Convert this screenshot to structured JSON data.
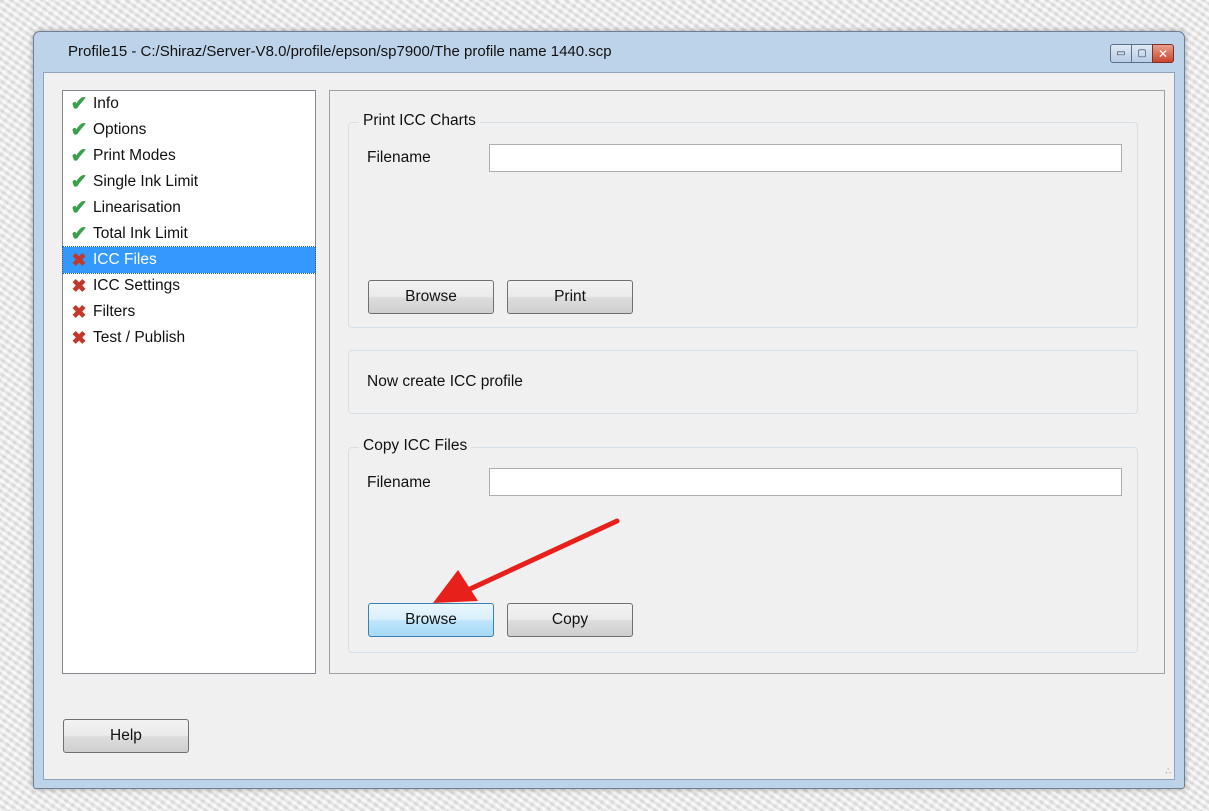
{
  "window": {
    "title": "Profile15 - C:/Shiraz/Server-V8.0/profile/epson/sp7900/The profile name 1440.scp",
    "controls": {
      "minimize": "▭",
      "maximize": "▢",
      "close": "✕"
    }
  },
  "nav": {
    "items": [
      {
        "label": "Info",
        "status": "done"
      },
      {
        "label": "Options",
        "status": "done"
      },
      {
        "label": "Print Modes",
        "status": "done"
      },
      {
        "label": "Single Ink Limit",
        "status": "done"
      },
      {
        "label": "Linearisation",
        "status": "done"
      },
      {
        "label": "Total Ink Limit",
        "status": "done"
      },
      {
        "label": "ICC Files",
        "status": "todo",
        "selected": true
      },
      {
        "label": "ICC Settings",
        "status": "todo"
      },
      {
        "label": "Filters",
        "status": "todo"
      },
      {
        "label": "Test / Publish",
        "status": "todo"
      }
    ],
    "icons": {
      "done": "✔",
      "todo": "✖"
    },
    "colors": {
      "done": "#3aa04a",
      "todo": "#c0392b",
      "selected_bg": "#3399ff"
    }
  },
  "print_charts": {
    "legend": "Print ICC Charts",
    "filename_label": "Filename",
    "filename_value": "",
    "browse_label": "Browse",
    "print_label": "Print"
  },
  "create_profile": {
    "message": "Now create ICC profile"
  },
  "copy_files": {
    "legend": "Copy ICC Files",
    "filename_label": "Filename",
    "filename_value": "",
    "browse_label": "Browse",
    "copy_label": "Copy"
  },
  "footer": {
    "help_label": "Help"
  },
  "annotation": {
    "arrow_color": "#e8201c"
  }
}
